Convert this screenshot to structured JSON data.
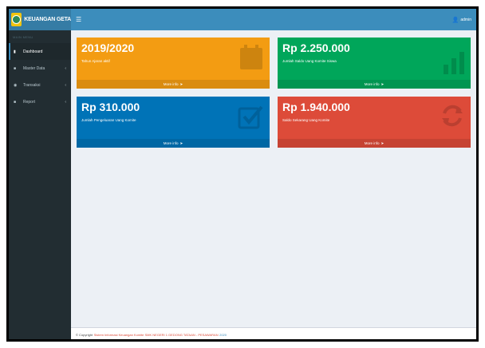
{
  "brand": {
    "title": "KEUANGAN GETA"
  },
  "user": {
    "name": "admin"
  },
  "sidebar": {
    "header": "MAIN MENU",
    "items": [
      {
        "label": "Dashboard",
        "icon": "dashboard-icon"
      },
      {
        "label": "Master Data",
        "icon": "folder-icon"
      },
      {
        "label": "Transaksi",
        "icon": "transaction-icon"
      },
      {
        "label": "Report",
        "icon": "report-icon"
      }
    ]
  },
  "boxes": [
    {
      "value": "2019/2020",
      "caption": "Tahun Ajaran aktif",
      "more": "More info",
      "color": "#f39c12",
      "icon": "calendar-icon"
    },
    {
      "value": "Rp 2.250.000",
      "caption": "Jumlah Saldo Uang Komite Siswa",
      "more": "More info",
      "color": "#00a65a",
      "icon": "bar-chart-icon"
    },
    {
      "value": "Rp 310.000",
      "caption": "Jumlah Pengeluaran Uang Komite",
      "more": "More info",
      "color": "#0073b7",
      "icon": "checkbox-icon"
    },
    {
      "value": "Rp 1.940.000",
      "caption": "Saldo Sekarang Uang Komite",
      "more": "More info",
      "color": "#dd4b39",
      "icon": "refresh-icon"
    }
  ],
  "footer": {
    "prefix": "© Copyright",
    "highlight": "Sistem Informasi Keuangan Komite SMK NEGERI 1 GEDONG TATAAN - PESAWARAN",
    "year": "2020"
  }
}
